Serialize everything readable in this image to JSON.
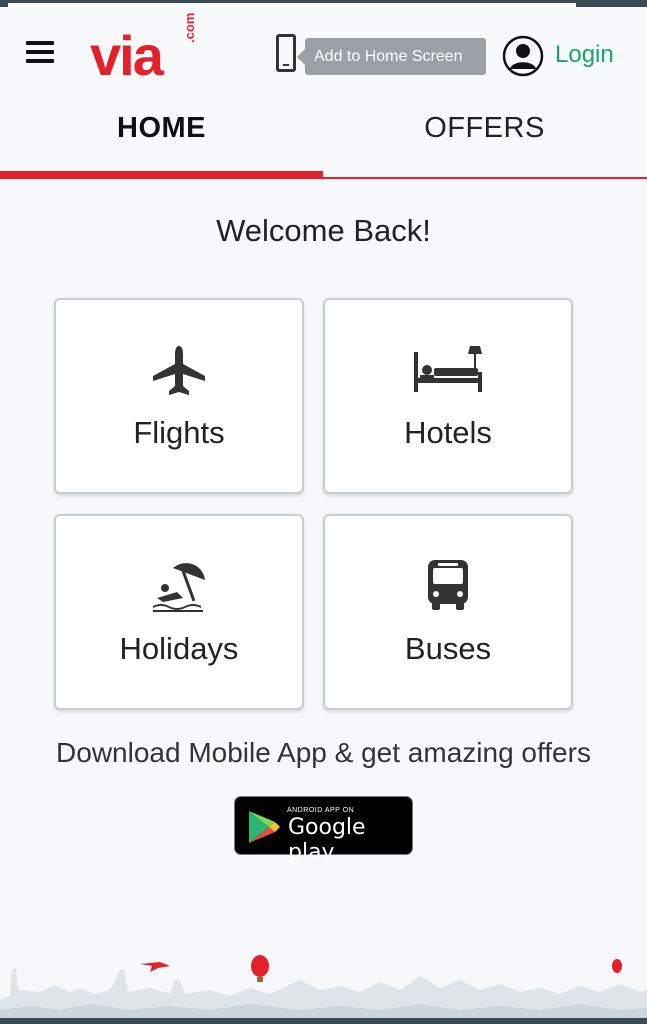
{
  "header": {
    "logo_text": "via",
    "logo_suffix": ".com",
    "add_to_home_label": "Add to Home Screen",
    "login_label": "Login"
  },
  "tabs": [
    {
      "label": "HOME",
      "active": true
    },
    {
      "label": "OFFERS",
      "active": false
    }
  ],
  "welcome": "Welcome Back!",
  "services": [
    {
      "label": "Flights",
      "icon": "airplane-icon"
    },
    {
      "label": "Hotels",
      "icon": "bed-icon"
    },
    {
      "label": "Holidays",
      "icon": "beach-umbrella-icon"
    },
    {
      "label": "Buses",
      "icon": "bus-icon"
    }
  ],
  "download_text": "Download Mobile App & get amazing offers",
  "google_play": {
    "small": "ANDROID APP ON",
    "big": "Google play"
  },
  "colors": {
    "brand_red": "#e4202a",
    "login_green": "#1aa56a"
  }
}
